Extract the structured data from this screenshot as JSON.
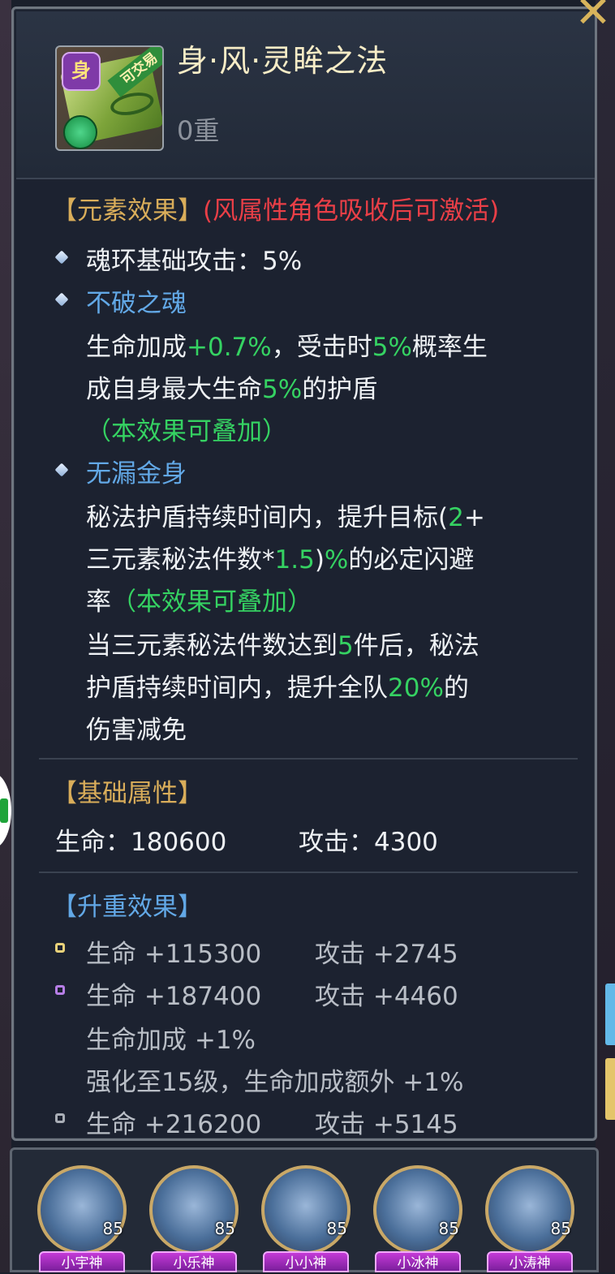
{
  "item": {
    "title": "身·风·灵眸之法",
    "level": "0重",
    "tradable_badge": "可交易",
    "element_badge": "身"
  },
  "element_effect": {
    "header": "【元素效果】",
    "condition": "(风属性角色吸收后可激活)",
    "base_attack_line": "魂环基础攻击：5%",
    "skill1": {
      "name": "不破之魂",
      "line1_a": "生命加成",
      "line1_b": "+0.7%",
      "line1_c": "，受击时",
      "line1_d": "5%",
      "line1_e": "概率生",
      "line2_a": "成自身最大生命",
      "line2_b": "5%",
      "line2_c": "的护盾",
      "stack_note": "（本效果可叠加）"
    },
    "skill2": {
      "name": "无漏金身",
      "line1_a": "秘法护盾持续时间内，提升目标(",
      "line1_b": "2",
      "line1_c": "+",
      "line2_a": "三元素秘法件数*",
      "line2_b": "1.5",
      "line2_c": ")",
      "line2_d": "%",
      "line2_e": "的必定闪避",
      "line3_a": "率",
      "line3_b": "（本效果可叠加）",
      "line4_a": "当三元素秘法件数达到",
      "line4_b": "5",
      "line4_c": "件后，秘法",
      "line5_a": "护盾持续时间内，提升全队",
      "line5_b": "20%",
      "line5_c": "的",
      "line6": "伤害减免"
    }
  },
  "base_attributes": {
    "header": "【基础属性】",
    "life": "生命：180600",
    "attack": "攻击：4300"
  },
  "upgrade": {
    "header": "【升重效果】",
    "tiers": [
      {
        "life": "生命 +115300",
        "attack": "攻击 +2745",
        "color": "#e9d27a"
      },
      {
        "life": "生命 +187400",
        "attack": "攻击 +4460",
        "color": "#b67ee6",
        "extra1": "生命加成 +1%",
        "extra2": "强化至15级，生命加成额外 +1%"
      },
      {
        "life": "生命 +216200",
        "attack": "攻击 +5145",
        "color": "#a9aeb6"
      }
    ]
  },
  "heroes": [
    {
      "name": "小宇神",
      "level": "85"
    },
    {
      "name": "小乐神",
      "level": "85"
    },
    {
      "name": "小小神",
      "level": "85"
    },
    {
      "name": "小冰神",
      "level": "85"
    },
    {
      "name": "小涛神",
      "level": "85"
    }
  ],
  "colors": {
    "gold": "#d9ad5a",
    "red": "#ea3f47",
    "blue": "#62a8e6",
    "green": "#35d262"
  },
  "icons": [
    "close-icon",
    "diamond-bullet-icon",
    "wind-element-icon"
  ]
}
